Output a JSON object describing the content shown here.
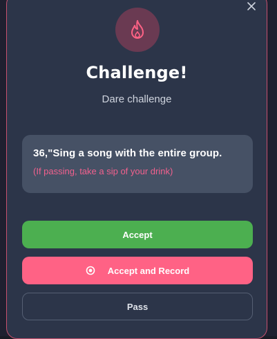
{
  "dialog": {
    "title": "Challenge!",
    "subtitle": "Dare challenge",
    "close_icon": "close-icon",
    "header_icon": "flame-icon"
  },
  "dare": {
    "text": "36,\"Sing a song with the entire group.",
    "note": "(If passing, take a sip of your drink)"
  },
  "buttons": {
    "accept_label": "Accept",
    "record_label": "Accept and Record",
    "record_icon": "record-icon",
    "pass_label": "Pass"
  },
  "colors": {
    "modal_bg": "#2c3549",
    "modal_border": "#c9516f",
    "accent_pink": "#ff6285",
    "accept_green": "#4caf50",
    "note_pink": "#f2618e",
    "icon_circle": "#6a3a52"
  }
}
